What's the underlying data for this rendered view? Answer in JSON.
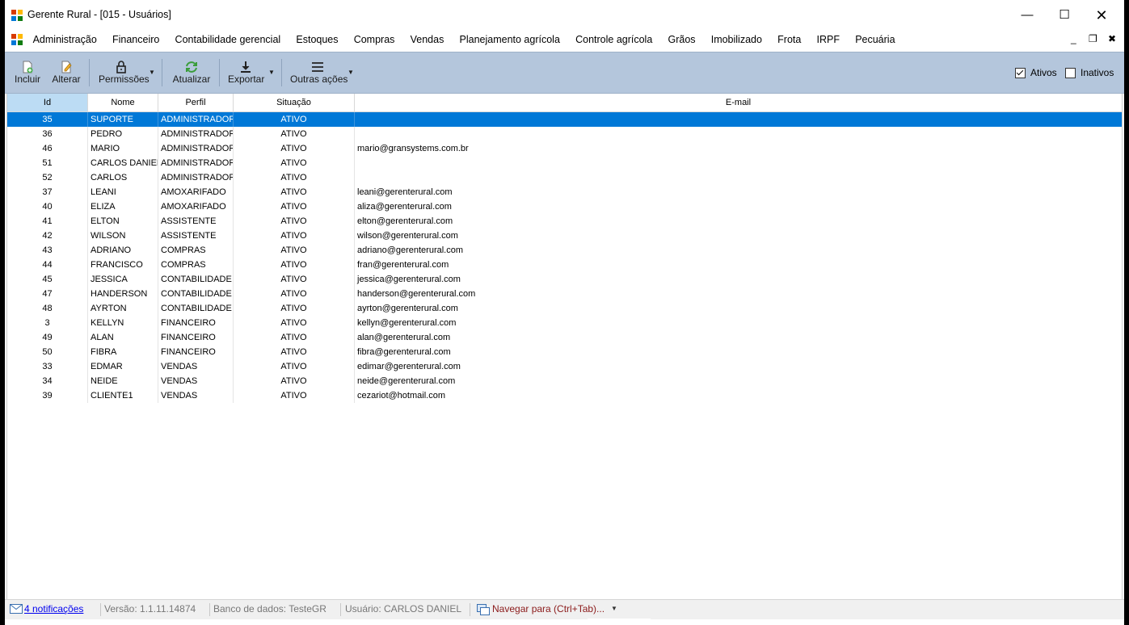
{
  "window": {
    "title": "Gerente Rural - [015 - Usuários]",
    "controls": {
      "minimize": "—",
      "maximize": "☐",
      "close": "✕"
    }
  },
  "menu": {
    "items": [
      "Administração",
      "Financeiro",
      "Contabilidade gerencial",
      "Estoques",
      "Compras",
      "Vendas",
      "Planejamento agrícola",
      "Controle agrícola",
      "Grãos",
      "Imobilizado",
      "Frota",
      "IRPF",
      "Pecuária"
    ],
    "mdi_controls": {
      "minimize": "_",
      "restore": "❐",
      "close": "✖"
    }
  },
  "toolbar": {
    "incluir": "Incluir",
    "alterar": "Alterar",
    "permissoes": "Permissões",
    "atualizar": "Atualizar",
    "exportar": "Exportar",
    "outras_acoes": "Outras ações",
    "ativos": {
      "label": "Ativos",
      "checked": true
    },
    "inativos": {
      "label": "Inativos",
      "checked": false
    }
  },
  "grid": {
    "columns": [
      "Id",
      "Nome",
      "Perfil",
      "Situação",
      "E-mail"
    ],
    "selected_row": 0,
    "rows": [
      [
        "35",
        "SUPORTE",
        "ADMINISTRADOR",
        "ATIVO",
        ""
      ],
      [
        "36",
        "PEDRO",
        "ADMINISTRADOR",
        "ATIVO",
        ""
      ],
      [
        "46",
        "MARIO",
        "ADMINISTRADOR",
        "ATIVO",
        "mario@gransystems.com.br"
      ],
      [
        "51",
        "CARLOS DANIEL",
        "ADMINISTRADOR",
        "ATIVO",
        ""
      ],
      [
        "52",
        "CARLOS",
        "ADMINISTRADOR",
        "ATIVO",
        ""
      ],
      [
        "37",
        "LEANI",
        "AMOXARIFADO",
        "ATIVO",
        "leani@gerenterural.com"
      ],
      [
        "40",
        "ELIZA",
        "AMOXARIFADO",
        "ATIVO",
        "aliza@gerenterural.com"
      ],
      [
        "41",
        "ELTON",
        "ASSISTENTE",
        "ATIVO",
        "elton@gerenterural.com"
      ],
      [
        "42",
        "WILSON",
        "ASSISTENTE",
        "ATIVO",
        "wilson@gerenterural.com"
      ],
      [
        "43",
        "ADRIANO",
        "COMPRAS",
        "ATIVO",
        "adriano@gerenterural.com"
      ],
      [
        "44",
        "FRANCISCO",
        "COMPRAS",
        "ATIVO",
        "fran@gerenterural.com"
      ],
      [
        "45",
        "JESSICA",
        "CONTABILIDADE",
        "ATIVO",
        "jessica@gerenterural.com"
      ],
      [
        "47",
        "HANDERSON",
        "CONTABILIDADE",
        "ATIVO",
        "handerson@gerenterural.com"
      ],
      [
        "48",
        "AYRTON",
        "CONTABILIDADE",
        "ATIVO",
        "ayrton@gerenterural.com"
      ],
      [
        "3",
        "KELLYN",
        "FINANCEIRO",
        "ATIVO",
        "kellyn@gerenterural.com"
      ],
      [
        "49",
        "ALAN",
        "FINANCEIRO",
        "ATIVO",
        "alan@gerenterural.com"
      ],
      [
        "50",
        "FIBRA",
        "FINANCEIRO",
        "ATIVO",
        "fibra@gerenterural.com"
      ],
      [
        "33",
        "EDMAR",
        "VENDAS",
        "ATIVO",
        "edimar@gerenterural.com"
      ],
      [
        "34",
        "NEIDE",
        "VENDAS",
        "ATIVO",
        "neide@gerenterural.com"
      ],
      [
        "39",
        "CLIENTE1",
        "VENDAS",
        "ATIVO",
        "cezariot@hotmail.com"
      ]
    ]
  },
  "statusbar": {
    "notificacoes": "4 notificações",
    "versao": "Versão: 1.1.11.14874",
    "banco": "Banco de dados: TesteGR",
    "usuario": "Usuário: CARLOS DANIEL",
    "navegar": "Navegar para (Ctrl+Tab)..."
  },
  "colors": {
    "toolbar_bg": "#b4c6dc",
    "selection": "#0078d7",
    "header_active": "#bcdcf4"
  }
}
